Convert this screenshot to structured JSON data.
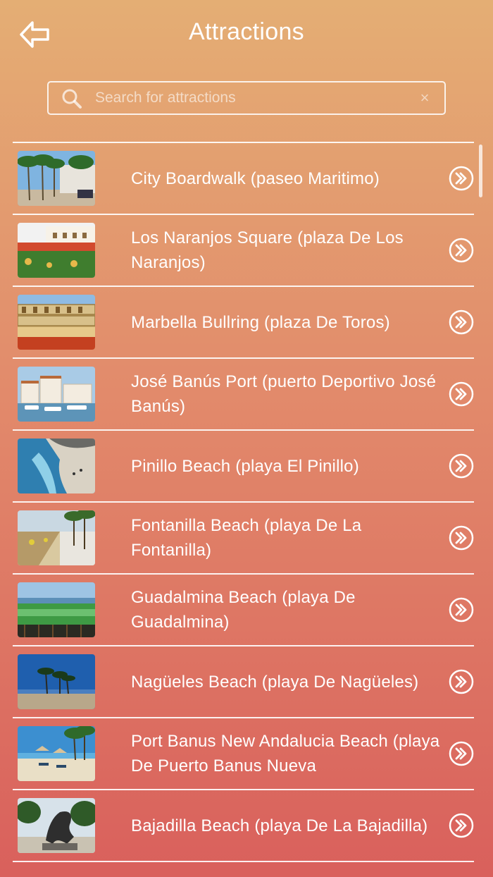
{
  "header": {
    "title": "Attractions",
    "back_icon": "back-arrow-icon"
  },
  "search": {
    "placeholder": "Search for attractions",
    "value": "",
    "icon": "search-icon",
    "clear_icon": "clear-icon",
    "clear_glyph": "×"
  },
  "attractions": [
    {
      "name": "City Boardwalk (paseo Maritimo)",
      "thumb": "boardwalk"
    },
    {
      "name": "Los Naranjos Square (plaza De Los Naranjos)",
      "thumb": "square"
    },
    {
      "name": "Marbella Bullring (plaza De Toros)",
      "thumb": "bullring"
    },
    {
      "name": "José Banús Port (puerto Deportivo José Banús)",
      "thumb": "port"
    },
    {
      "name": "Pinillo Beach (playa El Pinillo)",
      "thumb": "rocky-beach"
    },
    {
      "name": "Fontanilla Beach (playa De La Fontanilla)",
      "thumb": "promenade-beach"
    },
    {
      "name": "Guadalmina Beach (playa De Guadalmina)",
      "thumb": "golf"
    },
    {
      "name": "Nagüeles Beach (playa De Nagüeles)",
      "thumb": "palm-beach"
    },
    {
      "name": "Port Banus New Andalucia Beach (playa De Puerto Banus Nueva",
      "thumb": "umbrella-beach"
    },
    {
      "name": "Bajadilla Beach (playa De La Bajadilla)",
      "thumb": "sculpture"
    }
  ],
  "row_action_icon": "double-chevron-right-icon",
  "colors": {
    "gradient_top": "#e4ae74",
    "gradient_bottom": "#d9605c",
    "foreground": "#ffffff"
  }
}
